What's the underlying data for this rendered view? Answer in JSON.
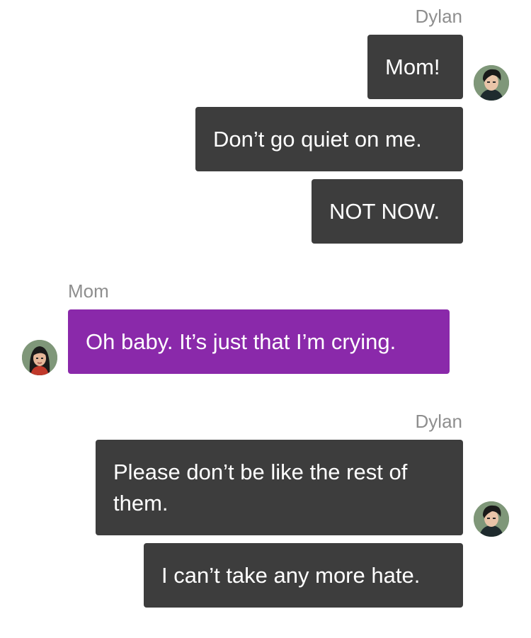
{
  "thread": {
    "group1": {
      "sender": "Dylan",
      "messages": [
        "Mom!",
        "Don’t go quiet on me.",
        "NOT NOW."
      ]
    },
    "group2": {
      "sender": "Mom",
      "messages": [
        "Oh baby. It’s just that I’m crying."
      ]
    },
    "group3": {
      "sender": "Dylan",
      "messages": [
        "Please don’t be like the rest of them.",
        "I can’t take any more hate."
      ]
    }
  },
  "colors": {
    "outgoing_bubble": "#3d3d3d",
    "incoming_bubble": "#8a29aa",
    "sender_label": "#8e8e8e",
    "background": "#ffffff"
  },
  "icons": {
    "dylan_avatar": "dylan-avatar",
    "mom_avatar": "mom-avatar"
  }
}
